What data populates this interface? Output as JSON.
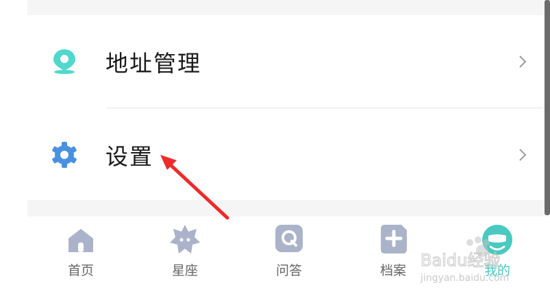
{
  "menu": {
    "items": [
      {
        "label": "地址管理",
        "icon": "location-pin-icon",
        "icon_color": "#4fd8cc"
      },
      {
        "label": "设置",
        "icon": "gear-icon",
        "icon_color": "#4a90e2"
      }
    ]
  },
  "tabbar": {
    "active_color": "#49c9c0",
    "inactive_icon_color": "#aab3c9",
    "tabs": [
      {
        "label": "首页",
        "icon": "home-icon",
        "active": false
      },
      {
        "label": "星座",
        "icon": "constellation-icon",
        "active": false
      },
      {
        "label": "问答",
        "icon": "qa-icon",
        "active": false
      },
      {
        "label": "档案",
        "icon": "archive-icon",
        "active": false
      },
      {
        "label": "我的",
        "icon": "profile-icon",
        "active": true
      }
    ]
  },
  "annotation": {
    "color": "#ee2a2a"
  },
  "watermark": {
    "text": "Baidu经验",
    "url": "jingyan.baidu.com"
  }
}
